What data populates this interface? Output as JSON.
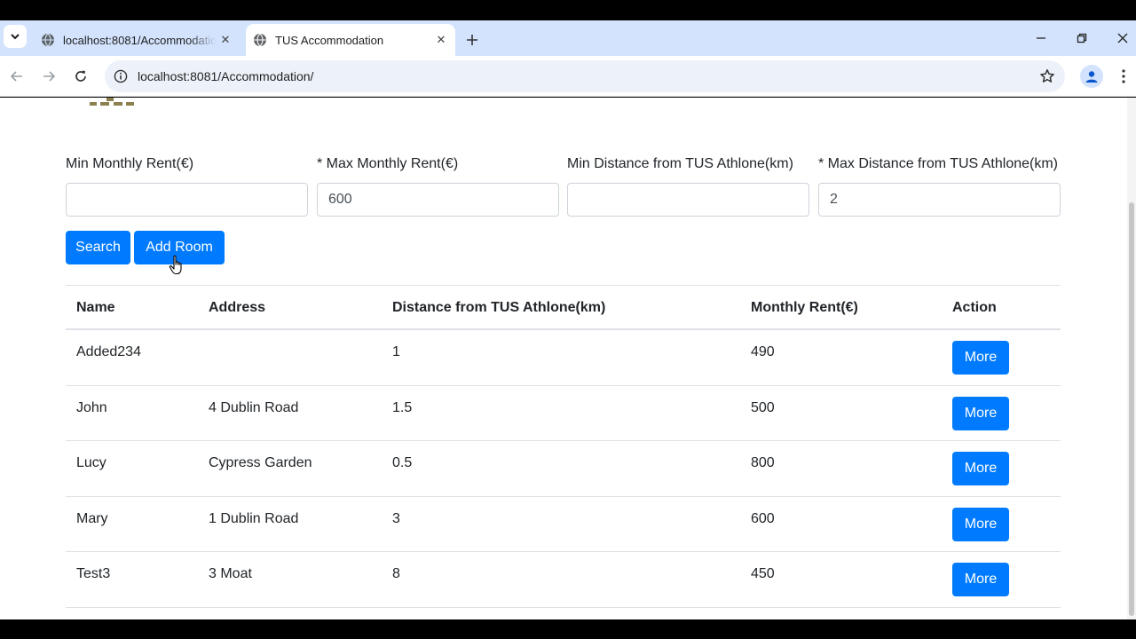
{
  "browser": {
    "tabs": [
      {
        "title": "localhost:8081/Accommodation/add",
        "active": false
      },
      {
        "title": "TUS Accommodation",
        "active": true
      }
    ],
    "url": "localhost:8081/Accommodation/"
  },
  "filters": {
    "min_rent": {
      "label": "Min Monthly Rent(€)",
      "value": ""
    },
    "max_rent": {
      "label": "* Max Monthly Rent(€)",
      "value": "600"
    },
    "min_distance": {
      "label": "Min Distance from TUS Athlone(km)",
      "value": ""
    },
    "max_distance": {
      "label": "* Max Distance from TUS Athlone(km)",
      "value": "2"
    }
  },
  "buttons": {
    "search": "Search",
    "add_room": "Add Room"
  },
  "table": {
    "headers": [
      "Name",
      "Address",
      "Distance from TUS Athlone(km)",
      "Monthly Rent(€)",
      "Action"
    ],
    "rows": [
      {
        "name": "Added234",
        "address": "",
        "distance": "1",
        "rent": "490",
        "action": "More"
      },
      {
        "name": "John",
        "address": "4 Dublin Road",
        "distance": "1.5",
        "rent": "500",
        "action": "More"
      },
      {
        "name": "Lucy",
        "address": "Cypress Garden",
        "distance": "0.5",
        "rent": "800",
        "action": "More"
      },
      {
        "name": "Mary",
        "address": "1 Dublin Road",
        "distance": "3",
        "rent": "600",
        "action": "More"
      },
      {
        "name": "Test3",
        "address": "3 Moat",
        "distance": "8",
        "rent": "450",
        "action": "More"
      }
    ]
  },
  "colors": {
    "primary": "#007bff",
    "tabstrip": "#d3e3fd",
    "omnibox": "#edf2fa"
  }
}
